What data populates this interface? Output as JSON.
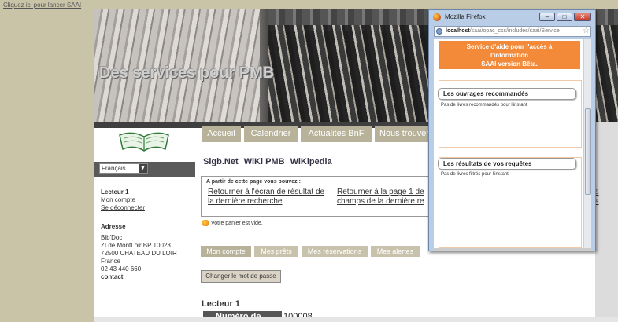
{
  "launch_link": "Cliquez ici pour lancer SAAI",
  "banner": {
    "title": "Des services pour PMB"
  },
  "language": {
    "selected": "Français"
  },
  "nav": {
    "tabs": [
      "Accueil",
      "Calendrier",
      "Actualités BnF",
      "Nous trouver"
    ]
  },
  "sidebar": {
    "reader_title": "Lecteur 1",
    "my_account": "Mon compte",
    "logout": "Se déconnecter",
    "address_title": "Adresse",
    "address_lines": [
      "Bib'Doc",
      "ZI de MontLoir BP 10023",
      "72500 CHATEAU DU LOIR",
      "France",
      "02 43 440 660"
    ],
    "contact": "contact"
  },
  "links": [
    "Sigb.Net",
    "WiKi PMB",
    "WiKipedia"
  ],
  "from_page": {
    "title": "A partir de cette page vous pouvez :",
    "link1_line1": "Retourner à l'écran de résultat de",
    "link1_line2": "la dernière recherche",
    "link2_line1": "Retourner à la page 1 de",
    "link2_line2": "champs de la dernière re",
    "link3_line1": "es",
    "link3_line2": "es"
  },
  "basket": "Votre panier est vide.",
  "account_tabs": [
    "Mon compte",
    "Mes prêts",
    "Mes réservations",
    "Mes alertes"
  ],
  "password_button": "Changer le mot de passe",
  "reader": {
    "heading": "Lecteur 1",
    "card_label": "Numéro de carte",
    "card_value": "100008"
  },
  "popup": {
    "window_title": "Mozilla Firefox",
    "url_host": "localhost",
    "url_path": "/saai/opac_css/includes/saai/Service",
    "header_line1": "Service d'aide pour l'accès à",
    "header_line2": "l'information",
    "header_line3": "SAAI version Bêta.",
    "section1_title": "Les ouvrages recommandés",
    "section1_text": "Pas de livres recommandés pour l'instant",
    "section2_title": "Les résultats de vos requêtes",
    "section2_text": "Pas de livres filtrés pour l'instant."
  }
}
